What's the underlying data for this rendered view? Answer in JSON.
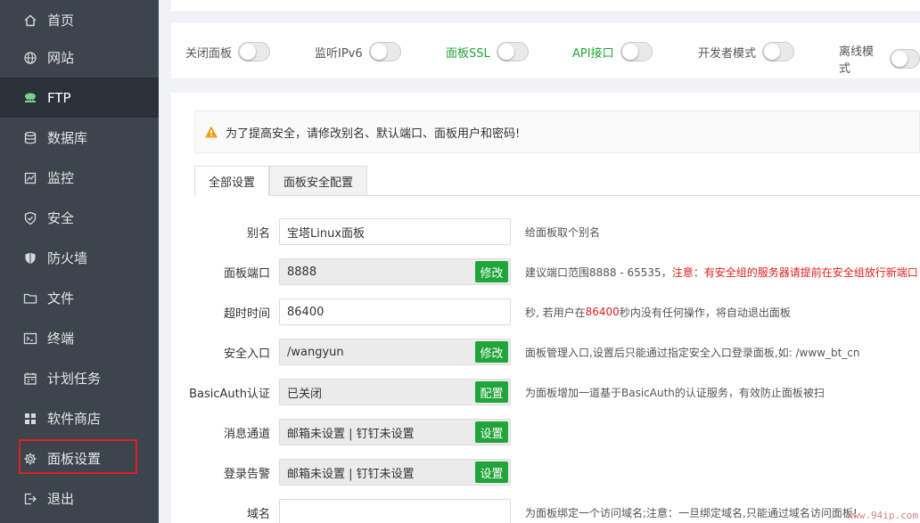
{
  "sidebar": {
    "items": [
      {
        "label": "首页",
        "icon": "home-icon"
      },
      {
        "label": "网站",
        "icon": "globe-icon"
      },
      {
        "label": "FTP",
        "icon": "ftp-icon"
      },
      {
        "label": "数据库",
        "icon": "database-icon"
      },
      {
        "label": "监控",
        "icon": "monitor-icon"
      },
      {
        "label": "安全",
        "icon": "shield-check-icon"
      },
      {
        "label": "防火墙",
        "icon": "shield-icon"
      },
      {
        "label": "文件",
        "icon": "folder-icon"
      },
      {
        "label": "终端",
        "icon": "terminal-icon"
      },
      {
        "label": "计划任务",
        "icon": "calendar-icon"
      },
      {
        "label": "软件商店",
        "icon": "apps-icon"
      },
      {
        "label": "面板设置",
        "icon": "gear-icon"
      },
      {
        "label": "退出",
        "icon": "logout-icon"
      }
    ],
    "active_index": 2,
    "highlighted_index": 11
  },
  "toggles": [
    {
      "label": "关闭面板",
      "on": false
    },
    {
      "label": "监听IPv6",
      "on": false
    },
    {
      "label": "面板SSL",
      "on": false
    },
    {
      "label": "API接口",
      "on": false
    },
    {
      "label": "开发者模式",
      "on": false
    },
    {
      "label": "离线模式",
      "on": false
    }
  ],
  "alert": {
    "text": "为了提高安全，请修改别名、默认端口、面板用户和密码!"
  },
  "tabs": [
    {
      "label": "全部设置",
      "active": true
    },
    {
      "label": "面板安全配置",
      "active": false
    }
  ],
  "form": {
    "alias": {
      "label": "别名",
      "value": "宝塔Linux面板",
      "desc": "给面板取个别名"
    },
    "port": {
      "label": "面板端口",
      "value": "8888",
      "button": "修改",
      "desc_a": "建议端口范围8888 - 65535，",
      "desc_b": "注意：有安全组的服务器请提前在安全组放行新端口"
    },
    "timeout": {
      "label": "超时时间",
      "value": "86400",
      "desc_a": "秒, 若用户在",
      "desc_b": "86400",
      "desc_c": "秒内没有任何操作，将自动退出面板"
    },
    "entry": {
      "label": "安全入口",
      "value": "/wangyun",
      "button": "修改",
      "desc": "面板管理入口,设置后只能通过指定安全入口登录面板,如: /www_bt_cn"
    },
    "basicauth": {
      "label": "BasicAuth认证",
      "value": "已关闭",
      "button": "配置",
      "desc": "为面板增加一道基于BasicAuth的认证服务，有效防止面板被扫"
    },
    "message": {
      "label": "消息通道",
      "value": "邮箱未设置 | 钉钉未设置",
      "button": "设置"
    },
    "login_alert": {
      "label": "登录告警",
      "value": "邮箱未设置 | 钉钉未设置",
      "button": "设置"
    },
    "domain": {
      "label": "域名",
      "value": "",
      "desc": "为面板绑定一个访问域名;注意：一旦绑定域名,只能通过域名访问面板!"
    }
  },
  "watermark": "www.94ip.com",
  "colors": {
    "sidebar_bg": "#3c444d",
    "accent_green": "#20a53a",
    "highlight_red": "#e02020"
  }
}
